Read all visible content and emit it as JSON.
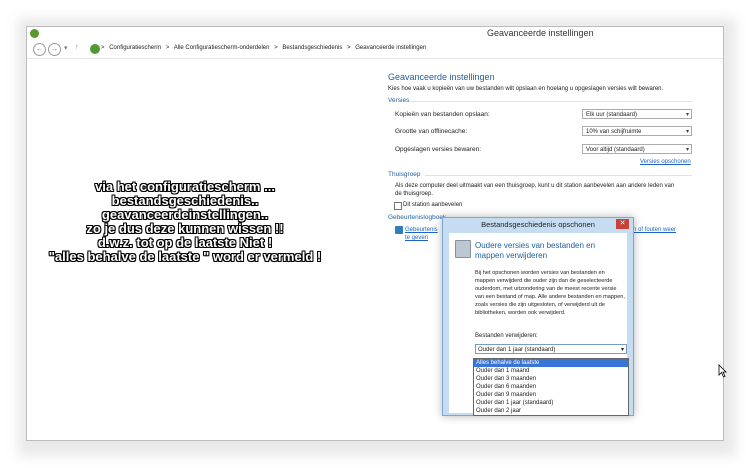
{
  "window": {
    "title": "Geavanceerde instellingen"
  },
  "address_bar": {
    "back": "←",
    "forward": "→",
    "recent": "▾",
    "up": "↑",
    "crumbs": [
      "Configuratiescherm",
      "Alle Configuratiescherm-onderdelen",
      "Bestandsgeschiedenis",
      "Geavanceerde instellingen"
    ],
    "separator": ">"
  },
  "overlay_text": [
    "via het configuratiescherm ...",
    "bestandsgeschiedenis..",
    "geavanceerdeinstellingen..",
    "zo je dus deze kunnen wissen  !!",
    "d.w.z. tot op de laatste  Niet !",
    "\"alles behalve de laatste \" word er vermeld !"
  ],
  "page": {
    "heading": "Geavanceerde instellingen",
    "description": "Kies hoe vaak u kopieën van uw bestanden wilt opslaan en hoelang u opgeslagen versies wilt bewaren.",
    "versions_section": "Versies",
    "copies_label": "Kopieën van bestanden opslaan:",
    "copies_value": "Elk uur (standaard)",
    "cache_label": "Grootte van offlinecache:",
    "cache_value": "10% van schijfruimte",
    "keep_label": "Opgeslagen versies bewaren:",
    "keep_value": "Voor altijd (standaard)",
    "cleanup_link": "Versies opschonen",
    "homegroup_section": "Thuisgroep",
    "homegroup_text_1": "Als deze computer deel uitmaakt van een thuisgroep, kunt u dit station aanbevelen aan andere leden van",
    "homegroup_text_2": "de thuisgroep.",
    "recommend_label": "Dit station aanbevelen",
    "eventlog_section": "Gebeurtenislogboek",
    "eventlog_link_1": "Gebeurtenis",
    "eventlog_link_2": "te geven",
    "eventlog_link_right": "n of fouten weer"
  },
  "dialog": {
    "title": "Bestandsgeschiedenis opschonen",
    "close": "✕",
    "heading_1": "Oudere versies van bestanden en",
    "heading_2": "mappen verwijderen",
    "body": "Bij het opschonen worden versies van bestanden en mappen verwijderd die ouder zijn dan de geselecteerde ouderdom, met uitzondering van de meest recente versie van een bestand of map. Alle andere bestanden en mappen, zoals versies die zijn uitgesloten, of verwijderd uit de bibliotheken, worden ook verwijderd.",
    "delete_label": "Bestanden verwijderen:",
    "selected": "Ouder dan 1 jaar (standaard)",
    "options": [
      "Alles behalve de laatste",
      "Ouder dan 1 maand",
      "Ouder dan 3 maanden",
      "Ouder dan 6 maanden",
      "Ouder dan 9 maanden",
      "Ouder dan 1 jaar (standaard)",
      "Ouder dan 2 jaar"
    ],
    "highlighted_index": 0
  },
  "icons": {
    "app": "file-history-icon",
    "dropdown_arrow": "▾",
    "cursor": "mouse-cursor-icon"
  }
}
